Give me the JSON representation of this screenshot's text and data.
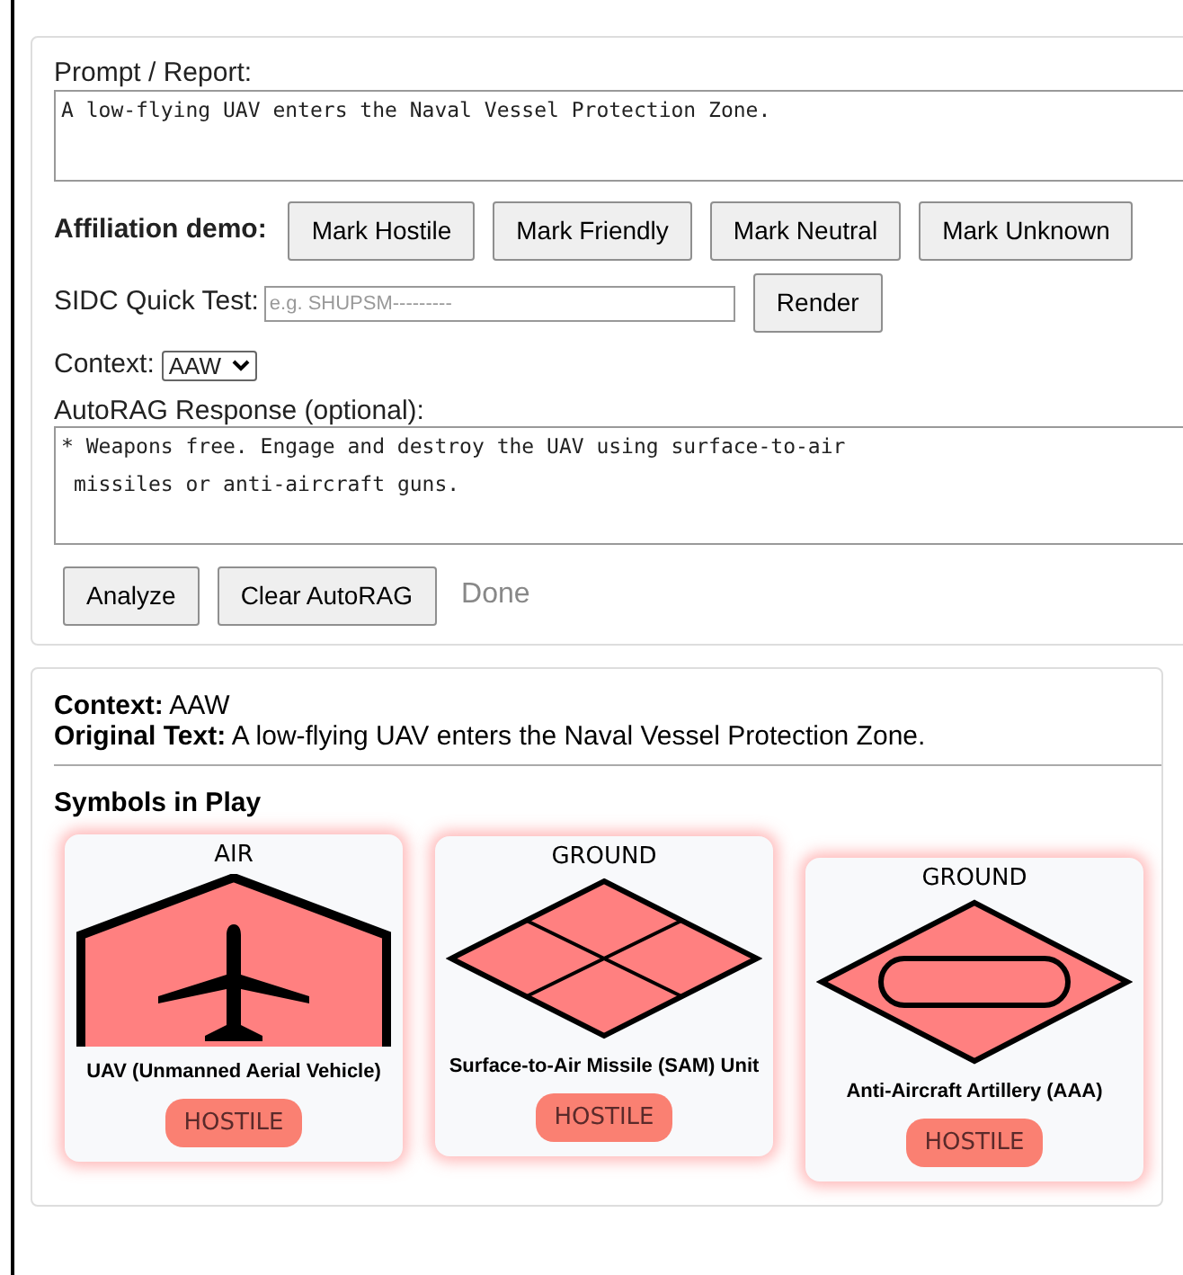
{
  "prompt": {
    "label": "Prompt / Report:",
    "value": "A low-flying UAV enters the Naval Vessel Protection Zone."
  },
  "affiliation": {
    "label": "Affiliation demo:",
    "buttons": [
      "Mark Hostile",
      "Mark Friendly",
      "Mark Neutral",
      "Mark Unknown"
    ]
  },
  "sidc": {
    "label": "SIDC Quick Test:",
    "placeholder": "e.g. SHUPSM---------",
    "button": "Render"
  },
  "context": {
    "label": "Context:",
    "value": "AAW"
  },
  "autorag": {
    "label": "AutoRAG Response (optional):",
    "value": "* Weapons free. Engage and destroy the UAV using surface-to-air\n missiles or anti-aircraft guns."
  },
  "actions": {
    "buttons": [
      "Analyze",
      "Clear AutoRAG"
    ],
    "status": "Done"
  },
  "result": {
    "context_label": "Context:",
    "context": "AAW",
    "text_label": "Original Text:",
    "text": "A low-flying UAV enters the Naval Vessel Protection Zone.",
    "heading": "Symbols in Play",
    "symbols": [
      {
        "kind": "air-aircraft",
        "dimension": "AIR",
        "name": "UAV (Unmanned Aerial Vehicle)",
        "affiliation": "HOSTILE"
      },
      {
        "kind": "ground-quadrants",
        "dimension": "GROUND",
        "name": "Surface-to-Air Missile (SAM) Unit",
        "affiliation": "HOSTILE"
      },
      {
        "kind": "ground-oval",
        "dimension": "GROUND",
        "name": "Anti-Aircraft Artillery (AAA)",
        "affiliation": "HOSTILE"
      }
    ]
  }
}
